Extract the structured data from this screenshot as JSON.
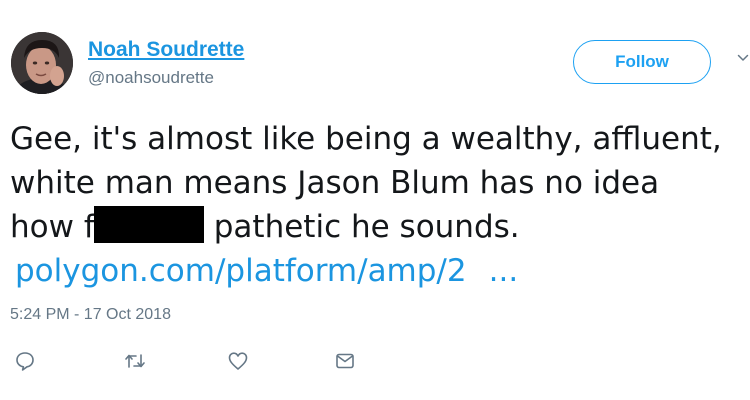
{
  "author": {
    "name": "Noah Soudrette",
    "handle": "@noahsoudrette"
  },
  "follow_button": {
    "label": "Follow"
  },
  "tweet": {
    "line1": "Gee, it's almost like being a wealthy, affluent,",
    "line2": "white man means Jason Blum has no idea",
    "line3_start": "how f",
    "line3_end": "pathetic he sounds.",
    "link_text": "polygon.com/platform/amp/2",
    "link_ellipsis": "..."
  },
  "timestamp": "5:24 PM - 17 Oct 2018",
  "actions": {
    "icons": [
      "reply-icon",
      "retweet-icon",
      "like-icon",
      "message-icon"
    ]
  },
  "colors": {
    "link": "#1b95e0",
    "follow": "#1da1f2",
    "muted": "#657786",
    "text": "#14171a"
  }
}
